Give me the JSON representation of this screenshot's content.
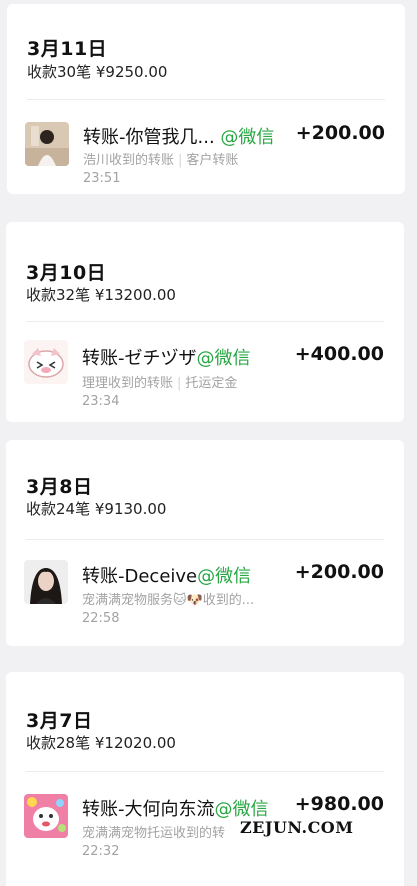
{
  "cards": [
    {
      "date": "3月11日",
      "summary": "收款30笔 ¥9250.00",
      "title": "转账-你管我几...",
      "channel": "@微信",
      "amount": "+200.00",
      "receiver": "浩川收到的转账",
      "note": "客户转账",
      "time": "23:51"
    },
    {
      "date": "3月10日",
      "summary": "收款32笔 ¥13200.00",
      "title": "转账-ゼチヅザ",
      "channel": "@微信",
      "amount": "+400.00",
      "receiver": "理理收到的转账",
      "note": "托运定金",
      "time": "23:34"
    },
    {
      "date": "3月8日",
      "summary": "收款24笔 ¥9130.00",
      "title": "转账-Deceive",
      "channel": "@微信",
      "amount": "+200.00",
      "subtitle": "宠满满宠物服务🐱🐶收到的...",
      "time": "22:58"
    },
    {
      "date": "3月7日",
      "summary": "收款28笔 ¥12020.00",
      "title": "转账-大何向东流",
      "channel": "@微信",
      "amount": "+980.00",
      "subtitle": "宠满满宠物托运收到的转",
      "time": "22:32"
    }
  ],
  "watermark": "ZEJUN.COM",
  "colors": {
    "channel_green": "#29a744",
    "page_bg": "#f1f1f3"
  }
}
